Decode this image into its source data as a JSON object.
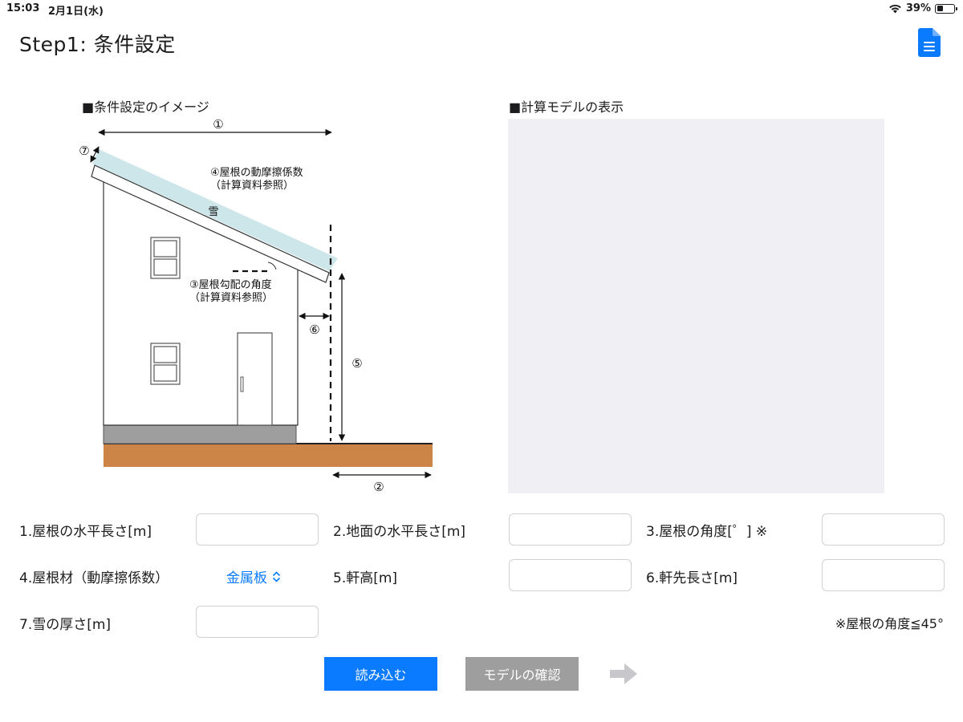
{
  "status": {
    "time": "15:03",
    "date": "2月1日(水)",
    "battery": "39%",
    "battery_level": 0.39
  },
  "title": "Step1:  条件設定",
  "sections": {
    "image_title": "■条件設定のイメージ",
    "model_title": "■計算モデルの表示"
  },
  "diagram": {
    "n1": "①",
    "n2": "②",
    "n5": "⑤",
    "n6": "⑥",
    "n7": "⑦",
    "snow": "雪",
    "friction_1": "④屋根の動摩擦係数",
    "friction_2": "（計算資料参照）",
    "angle_1": "③屋根勾配の角度",
    "angle_2": "（計算資料参照）"
  },
  "fields": {
    "f1": {
      "label": "1.屋根の水平長さ[m]",
      "value": ""
    },
    "f2": {
      "label": "2.地面の水平長さ[m]",
      "value": ""
    },
    "f3": {
      "label": "3.屋根の角度[゜] ※",
      "value": ""
    },
    "f4": {
      "label": "4.屋根材（動摩擦係数）",
      "value": "金属板"
    },
    "f5": {
      "label": "5.軒高[m]",
      "value": ""
    },
    "f6": {
      "label": "6.軒先長さ[m]",
      "value": ""
    },
    "f7": {
      "label": "7.雪の厚さ[m]",
      "value": ""
    }
  },
  "note": "※屋根の角度≦45°",
  "buttons": {
    "load": "読み込む",
    "check": "モデルの確認"
  },
  "icons": {
    "doc": "document-icon",
    "next": "arrow-right-icon",
    "wifi": "wifi-icon",
    "battery": "battery-icon",
    "select": "chevron-updown-icon"
  },
  "colors": {
    "accent": "#0a7aff",
    "disabled_button": "#9e9e9e",
    "model_bg": "#efeff4",
    "snow": "#cde6ea",
    "ground": "#cc8547",
    "foundation": "#9e9e9e"
  }
}
